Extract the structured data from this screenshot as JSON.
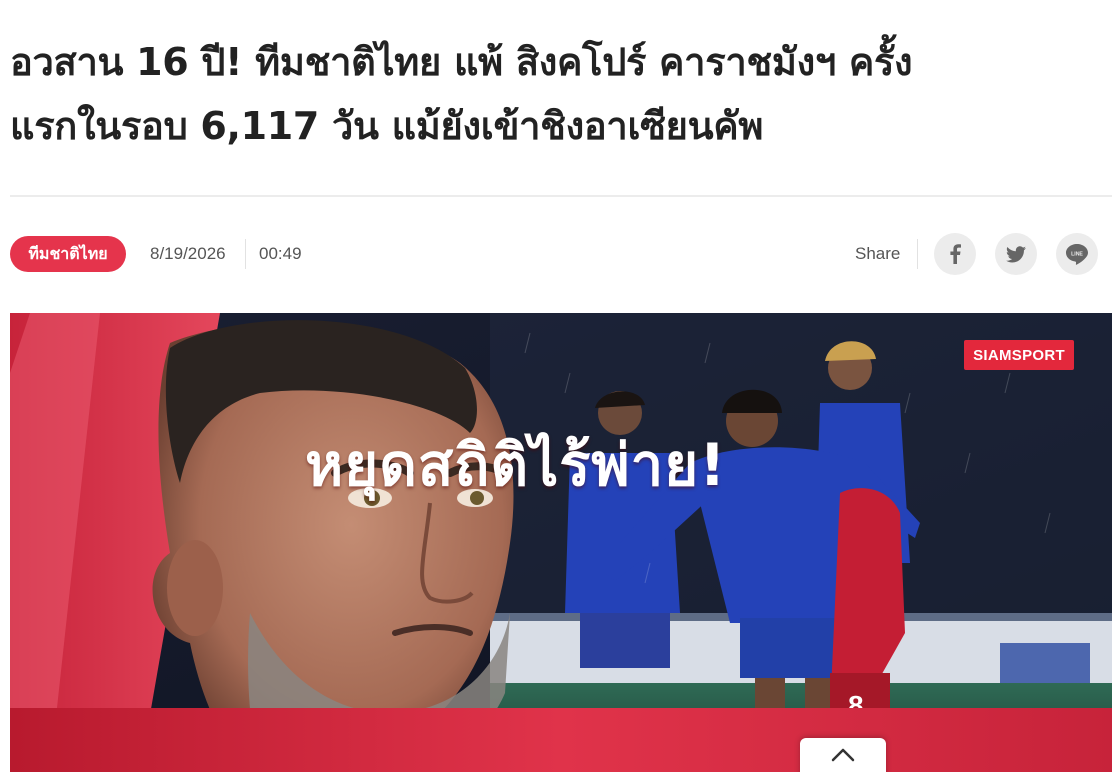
{
  "article": {
    "headline_line1": "อวสาน 16 ปี! ทีมชาติไทย แพ้ สิงคโปร์ คาราชมังฯ ครั้ง",
    "headline_line2": "แรกในรอบ 6,117 วัน แม้ยังเข้าชิงอาเซียนคัพ",
    "category_tag": "ทีมชาติไทย",
    "date": "8/19/2026",
    "time": "00:49"
  },
  "share": {
    "label": "Share",
    "buttons": [
      {
        "icon": "facebook-icon"
      },
      {
        "icon": "twitter-icon"
      },
      {
        "icon": "line-icon",
        "text": "LINE"
      }
    ]
  },
  "hero_image": {
    "brand_badge": "SIAMSPORT",
    "overlay_caption": "หยุดสถิติไร้พ่าย!",
    "jersey_number": "8"
  },
  "colors": {
    "tag_background": "#e5344c",
    "brand_red": "#e3283c",
    "jersey_blue": "#2442b8",
    "share_button_bg": "#ececec"
  },
  "controls": {
    "scroll_top_icon": "chevron-up-icon"
  }
}
